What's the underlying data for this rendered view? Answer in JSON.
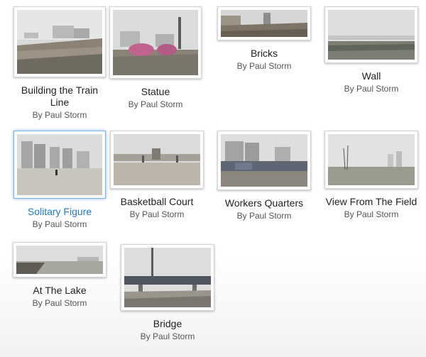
{
  "gallery": {
    "items": [
      {
        "title": "Building the Train Line",
        "byline": "By Paul Storm",
        "scene": "building-train-line"
      },
      {
        "title": "Statue",
        "byline": "By Paul Storm",
        "scene": "statue"
      },
      {
        "title": "Bricks",
        "byline": "By Paul Storm",
        "scene": "bricks"
      },
      {
        "title": "Wall",
        "byline": "By Paul Storm",
        "scene": "wall"
      },
      {
        "title": "Solitary Figure",
        "byline": "By Paul Storm",
        "scene": "solitary-figure",
        "selected": true
      },
      {
        "title": "Basketball Court",
        "byline": "By Paul Storm",
        "scene": "basketball-court"
      },
      {
        "title": "Workers Quarters",
        "byline": "By Paul Storm",
        "scene": "workers-quarters"
      },
      {
        "title": "View From The Field",
        "byline": "By Paul Storm",
        "scene": "view-from-field"
      },
      {
        "title": "At The Lake",
        "byline": "By Paul Storm",
        "scene": "at-the-lake"
      },
      {
        "title": "Bridge",
        "byline": "By Paul Storm",
        "scene": "bridge"
      }
    ]
  },
  "colors": {
    "selected_title": "#1f7acb",
    "title": "#222222",
    "byline": "#555555"
  }
}
